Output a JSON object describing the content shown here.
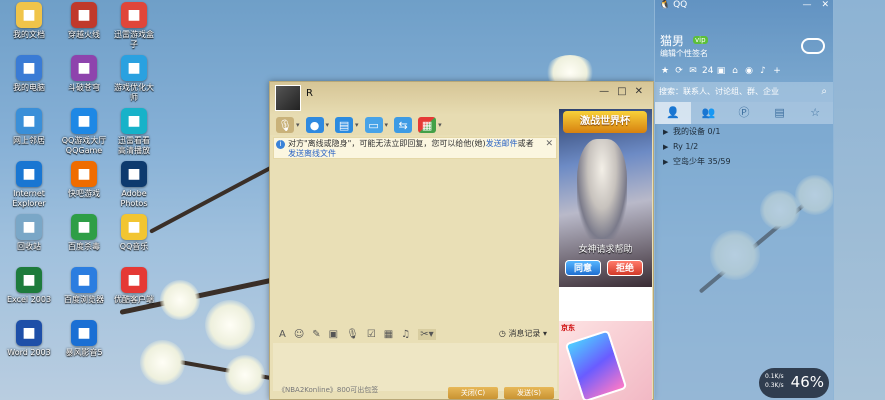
{
  "desktop": {
    "icons": [
      {
        "label": "我的文档",
        "icon": "folder-icon",
        "color": "#f0c44a"
      },
      {
        "label": "穿越火线",
        "icon": "cf-game-icon",
        "color": "#c0392b"
      },
      {
        "label": "迅雷游戏盒\n子",
        "icon": "xunlei-box-icon",
        "color": "#e0463a"
      },
      {
        "label": "我的电脑",
        "icon": "computer-icon",
        "color": "#3a7bd5"
      },
      {
        "label": "斗破苍穹",
        "icon": "game-icon",
        "color": "#8e44ad"
      },
      {
        "label": "游戏优化大\n师",
        "icon": "optimizer-icon",
        "color": "#2aa1e0"
      },
      {
        "label": "网上邻居",
        "icon": "network-icon",
        "color": "#3a8fd8"
      },
      {
        "label": "QQ游戏大厅\nQQGame",
        "icon": "qqgame-icon",
        "color": "#1e88e5"
      },
      {
        "label": "迅雷看看\n高清播放",
        "icon": "xunlei-kankan-icon",
        "color": "#17b2c9"
      },
      {
        "label": "Internet\nExplorer",
        "icon": "ie-icon",
        "color": "#1976d2"
      },
      {
        "label": "快吧游戏",
        "icon": "kuaiba-icon",
        "color": "#ef6c00"
      },
      {
        "label": "Adobe\nPhotos",
        "icon": "photoshop-icon",
        "color": "#0d3a6e"
      },
      {
        "label": "回收站",
        "icon": "recycle-bin-icon",
        "color": "#7aa7c7"
      },
      {
        "label": "百度杀毒",
        "icon": "antivirus-icon",
        "color": "#2e9e46"
      },
      {
        "label": "QQ音乐",
        "icon": "qqmusic-icon",
        "color": "#f2c531"
      },
      {
        "label": "Excel 2003",
        "icon": "excel-icon",
        "color": "#1e7b3c"
      },
      {
        "label": "百度浏览器",
        "icon": "baidu-browser-icon",
        "color": "#2b7de0"
      },
      {
        "label": "优酷客户端",
        "icon": "youku-icon",
        "color": "#e53935"
      },
      {
        "label": "Word 2003",
        "icon": "word-icon",
        "color": "#1e4fa8"
      },
      {
        "label": "暴风影音5",
        "icon": "baofeng-icon",
        "color": "#1a6fd4"
      }
    ]
  },
  "chat": {
    "contact_name": "R",
    "toolbar_icons": [
      "microphone-icon",
      "video-icon",
      "file-transfer-icon",
      "remote-desktop-icon",
      "share-screen-icon",
      "apps-icon"
    ],
    "notice": {
      "text": "对方\"离线或隐身\"，可能无法立即回复，您可以给他(她)",
      "link1": "发送邮件",
      "mid": "或者",
      "link2": "发送离线文件"
    },
    "input_tools": [
      "A",
      "☺",
      "✎",
      "▣",
      "♪",
      "☑",
      "▦",
      "♫",
      "✂"
    ],
    "history_label": "消息记录",
    "footer_text": "《NBA2Konline》800可出包签",
    "close_btn": "关闭(C)",
    "send_btn": "发送(S)"
  },
  "ad": {
    "game_title": "激战世界杯",
    "caption": "女神请求帮助",
    "agree": "同意",
    "refuse": "拒绝",
    "shop": "京东"
  },
  "qq": {
    "brand": "QQ",
    "nickname": "猫男",
    "vip_badge": "vip",
    "signature": "编辑个性签名",
    "status_count": "24",
    "search_placeholder": "搜索：联系人、讨论组、群、企业",
    "groups": [
      {
        "name": "我的设备 0/1"
      },
      {
        "name": "Ry 1/2"
      },
      {
        "name": "空岛少年 35/59"
      }
    ],
    "speed": {
      "up": "0.1K/s",
      "down": "0.3K/s",
      "percent": "46%"
    }
  }
}
